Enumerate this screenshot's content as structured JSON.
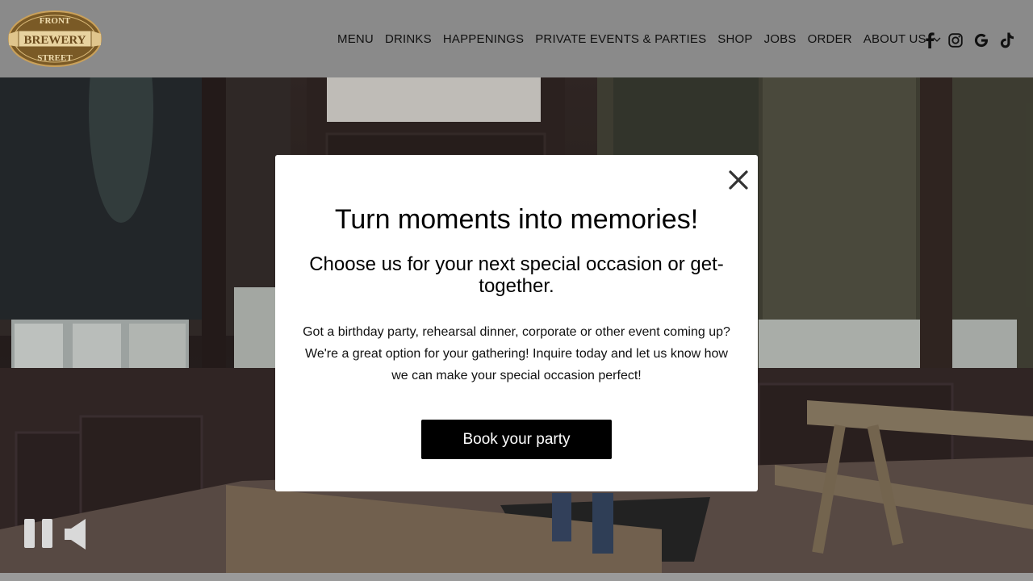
{
  "brand": {
    "logo_top": "FRONT",
    "logo_middle": "BREWERY",
    "logo_bottom": "STREET",
    "logo_color": "#7a5a26"
  },
  "nav": {
    "items": [
      {
        "label": "MENU"
      },
      {
        "label": "DRINKS"
      },
      {
        "label": "HAPPENINGS"
      },
      {
        "label": "PRIVATE EVENTS & PARTIES"
      },
      {
        "label": "SHOP"
      },
      {
        "label": "JOBS"
      },
      {
        "label": "ORDER"
      },
      {
        "label": "ABOUT US",
        "icon": "chevron-down-icon"
      }
    ]
  },
  "social": {
    "icons": [
      "facebook-icon",
      "instagram-icon",
      "google-icon",
      "tiktok-icon"
    ]
  },
  "video_controls": {
    "icons": [
      "pause-icon",
      "volume-icon"
    ]
  },
  "modal": {
    "title": "Turn moments into memories!",
    "subtitle": "Choose us for your next special occasion or get-together.",
    "body": "Got a birthday party, rehearsal dinner, corporate or other event coming up? We're a great option for your gathering! Inquire today and let us know how we can make your special occasion perfect!",
    "cta_label": "Book your party",
    "close_icon": "close-icon"
  },
  "colors": {
    "header_bg": "#8a8a8a",
    "modal_bg": "#ffffff",
    "cta_bg": "#000000",
    "cta_text": "#ffffff"
  }
}
